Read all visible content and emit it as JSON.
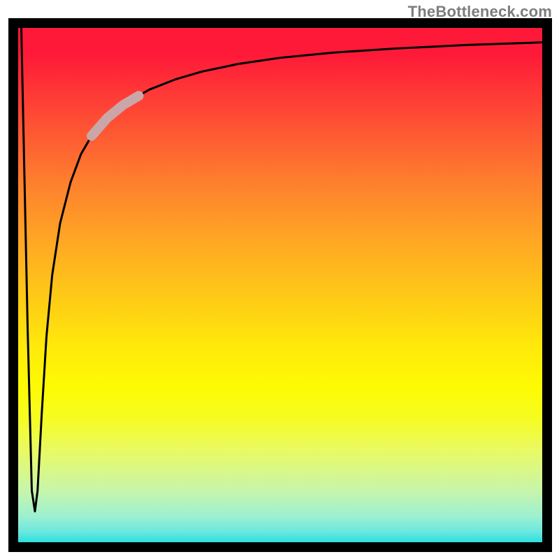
{
  "watermark": {
    "text": "TheBottleneck.com"
  },
  "chart_data": {
    "type": "line",
    "title": "",
    "xlabel": "",
    "ylabel": "",
    "xlim": [
      0,
      100
    ],
    "ylim": [
      0,
      100
    ],
    "grid": false,
    "legend": false,
    "series": [
      {
        "name": "bottleneck-curve",
        "x": [
          0.6,
          1.8,
          2.6,
          3.2,
          3.7,
          4.5,
          5.4,
          6.5,
          8,
          10,
          12,
          14,
          17,
          20,
          25,
          30,
          35,
          42,
          50,
          60,
          72,
          86,
          100
        ],
        "y": [
          100,
          42,
          10,
          6,
          10,
          25,
          40,
          52,
          62,
          70,
          75.5,
          79,
          82.5,
          85,
          88,
          90,
          91.5,
          93,
          94.2,
          95.2,
          96,
          96.7,
          97.2
        ]
      },
      {
        "name": "highlight-segment",
        "x": [
          14,
          17,
          20,
          23
        ],
        "y": [
          79,
          82.5,
          85,
          86.8
        ]
      }
    ],
    "colors": {
      "curve": "#000000",
      "highlight": "#caa6a8"
    },
    "highlight_thickness_px": 14
  }
}
